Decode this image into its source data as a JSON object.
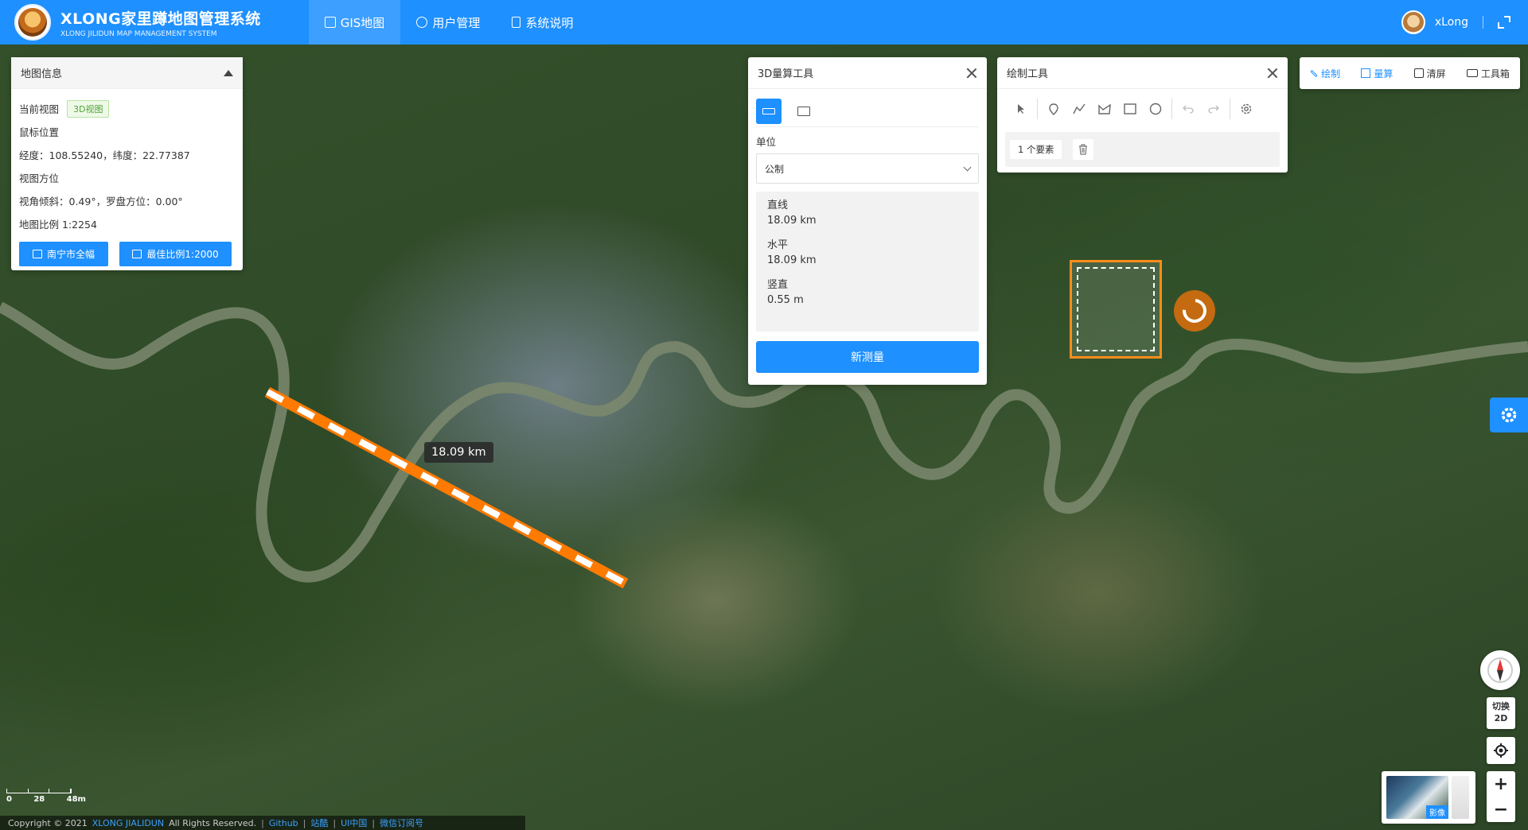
{
  "header": {
    "title": "XLONG家里蹲地图管理系统",
    "subtitle": "XLONG JILIDUN MAP MANAGEMENT SYSTEM",
    "nav": [
      {
        "label": "GIS地图",
        "active": true
      },
      {
        "label": "用户管理",
        "active": false
      },
      {
        "label": "系统说明",
        "active": false
      }
    ],
    "username": "xLong"
  },
  "map_info": {
    "title": "地图信息",
    "current_view_label": "当前视图",
    "current_view_tag": "3D视图",
    "mouse_position_label": "鼠标位置",
    "mouse_position_value": "经度：108.55240，纬度：22.77387",
    "view_orientation_label": "视图方位",
    "view_orientation_value": "视角倾斜：0.49°，罗盘方位：0.00°",
    "map_scale": "地图比例 1:2254",
    "btn_full_extent": "南宁市全幅",
    "btn_best_scale": "最佳比例1:2000"
  },
  "measure_panel": {
    "title": "3D量算工具",
    "unit_label": "单位",
    "unit_value": "公制",
    "results": [
      {
        "label": "直线",
        "value": "18.09 km"
      },
      {
        "label": "水平",
        "value": "18.09 km"
      },
      {
        "label": "竖直",
        "value": "0.55 m"
      }
    ],
    "new_button": "新测量"
  },
  "draw_panel": {
    "title": "绘制工具",
    "tools": [
      "pointer-icon",
      "marker-icon",
      "polyline-icon",
      "polygon-icon",
      "rectangle-icon",
      "circle-icon",
      "undo-icon",
      "redo-icon",
      "settings-icon"
    ],
    "feature_count": "1 个要素"
  },
  "toolbar": {
    "draw": "绘制",
    "measure": "量算",
    "clear": "清屏",
    "toolbox": "工具箱"
  },
  "map": {
    "measure_label": "18.09 km",
    "switch_label_top": "切换",
    "switch_label_bottom": "2D",
    "basemap_label": "影像"
  },
  "scale": {
    "ticks": [
      "0",
      "28",
      "48m"
    ]
  },
  "footer": {
    "copyright": "Copyright © 2021",
    "brand": "XLONG JIALIDUN",
    "rights": "All Rights Reserved.",
    "links": [
      "Github",
      "站酷",
      "UI中国",
      "微信订阅号"
    ]
  },
  "colors": {
    "primary": "#1e90ff",
    "measure_line": "#ff7a00"
  }
}
